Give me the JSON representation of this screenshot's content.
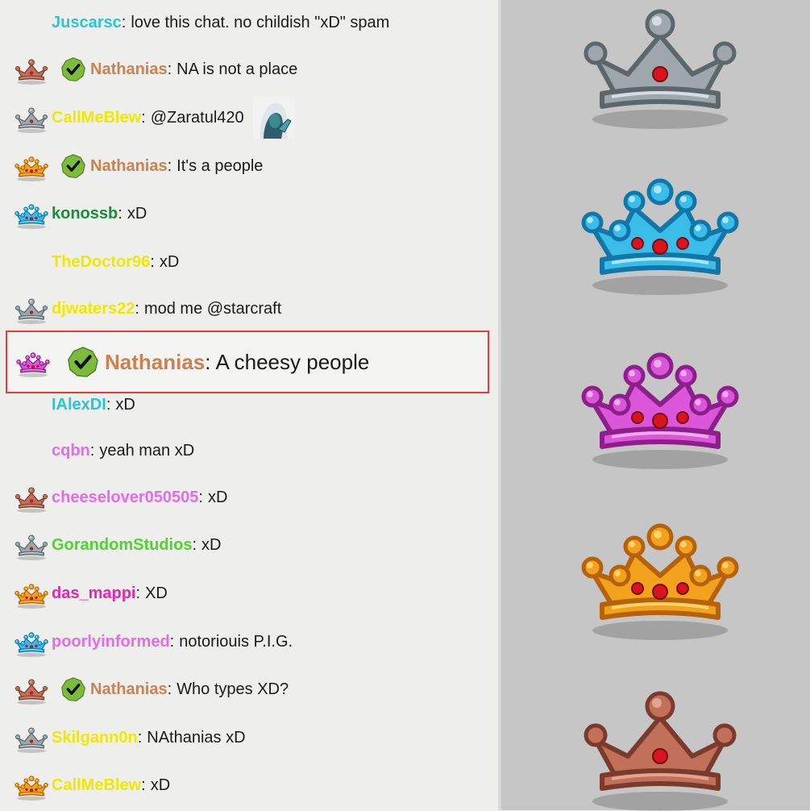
{
  "colors": {
    "teal": "#27c7d6",
    "brown_orange": "#c98250",
    "yellow": "#f0e800",
    "green_dark": "#1a8a3d",
    "pink": "#e46ce8",
    "bright_green": "#4ed42a",
    "magenta": "#e824b4",
    "highlight_border": "#e53b3b",
    "check_green": "#7dbb3c"
  },
  "chat": {
    "messages": [
      {
        "badge": "none",
        "verified": false,
        "user": "Juscarsc",
        "user_color": "#27c7d6",
        "text": "love this chat. no childish \"xD\" spam"
      },
      {
        "badge": "bronze-crown",
        "verified": true,
        "user": "Nathanias",
        "user_color": "#c98250",
        "text": "NA is not a place"
      },
      {
        "badge": "silver-crown",
        "verified": false,
        "user": "CallMeBlew",
        "user_color": "#f0e800",
        "text": "@Zaratul420",
        "emote": true
      },
      {
        "badge": "gold-crown",
        "verified": true,
        "user": "Nathanias",
        "user_color": "#c98250",
        "text": "It's a people"
      },
      {
        "badge": "blue-crown",
        "verified": false,
        "user": "konossb",
        "user_color": "#1a8a3d",
        "text": "xD"
      },
      {
        "badge": "none",
        "verified": false,
        "user": "TheDoctor96",
        "user_color": "#f0e800",
        "text": "xD"
      },
      {
        "badge": "silver-crown",
        "verified": false,
        "user": "djwaters22",
        "user_color": "#f0e800",
        "text": "mod me @starcraft"
      },
      {
        "badge": "none",
        "verified": false,
        "user": "IAlexDI",
        "user_color": "#27c7d6",
        "text": "xD"
      },
      {
        "badge": "none",
        "verified": false,
        "user": "cqbn",
        "user_color": "#e46ce8",
        "text": "yeah man xD"
      },
      {
        "badge": "bronze-crown",
        "verified": false,
        "user": "cheeselover050505",
        "user_color": "#e46ce8",
        "text": "xD"
      },
      {
        "badge": "silver-crown",
        "verified": false,
        "user": "GorandomStudios",
        "user_color": "#4ed42a",
        "text": "xD"
      },
      {
        "badge": "gold-crown",
        "verified": false,
        "user": "das_mappi",
        "user_color": "#e824b4",
        "text": "XD"
      },
      {
        "badge": "blue-crown",
        "verified": false,
        "user": "poorlyinformed",
        "user_color": "#e46ce8",
        "text": "notoriouis P.I.G."
      },
      {
        "badge": "bronze-crown",
        "verified": true,
        "user": "Nathanias",
        "user_color": "#c98250",
        "text": "Who types XD?"
      },
      {
        "badge": "silver-crown",
        "verified": false,
        "user": "Skilgann0n",
        "user_color": "#f0e800",
        "text": "NAthanias xD"
      },
      {
        "badge": "gold-crown",
        "verified": false,
        "user": "CallMeBlew",
        "user_color": "#f0e800",
        "text": "xD"
      }
    ],
    "highlighted": {
      "badge": "purple-crown",
      "verified": true,
      "user": "Nathanias",
      "user_color": "#c98250",
      "text": "A cheesy people"
    }
  },
  "crowns_panel": {
    "crowns": [
      {
        "name": "silver-crown"
      },
      {
        "name": "blue-crown"
      },
      {
        "name": "purple-crown"
      },
      {
        "name": "gold-crown"
      },
      {
        "name": "bronze-crown"
      }
    ]
  },
  "crown_palettes": {
    "silver-crown": {
      "base": "#9ea7ab",
      "dark": "#5c676c",
      "light": "#d6dde0"
    },
    "bronze-crown": {
      "base": "#c1705a",
      "dark": "#7a3a2c",
      "light": "#e5a38d"
    },
    "gold-crown": {
      "base": "#f3a21d",
      "dark": "#b5620a",
      "light": "#ffd36a"
    },
    "blue-crown": {
      "base": "#3bbde9",
      "dark": "#1277a8",
      "light": "#a7e6fb"
    },
    "purple-crown": {
      "base": "#d957d8",
      "dark": "#8c1f8c",
      "light": "#f2a8f0"
    }
  }
}
